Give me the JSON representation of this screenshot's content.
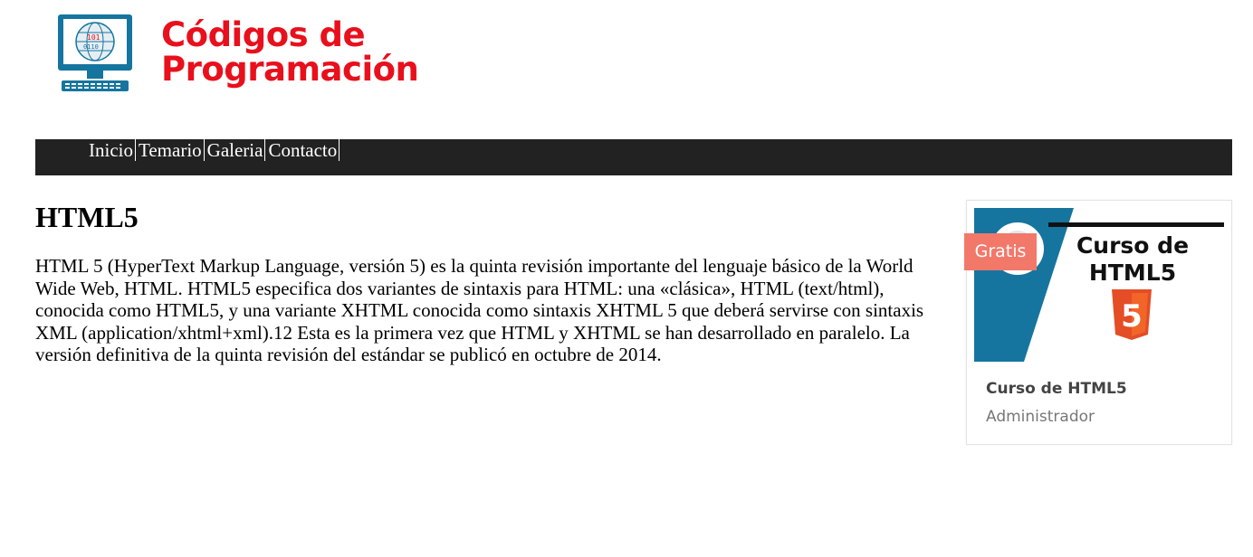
{
  "logo": {
    "line1": "Códigos de",
    "line2": "Programación",
    "icon": "computer-globe-icon",
    "color": "#e8101c"
  },
  "nav": {
    "items": [
      "Inicio",
      "Temario",
      "Galeria",
      "Contacto"
    ],
    "background": "#222222"
  },
  "main": {
    "title": "HTML5",
    "paragraph": "HTML 5 (HyperText Markup Language, versión 5) es la quinta revisión importante del lenguaje básico de la World Wide Web, HTML. HTML5 especifica dos variantes de sintaxis para HTML: una «clásica», HTML (text/html), conocida como HTML5, y una variante XHTML conocida como sintaxis XHTML 5 que deberá servirse con sintaxis XML (application/xhtml+xml).12 Esta es la primera vez que HTML y XHTML se han desarrollado en paralelo. La versión definitiva de la quinta revisión del estándar se publicó en octubre de 2014."
  },
  "card": {
    "badge": "Gratis",
    "image_title_line1": "Curso de",
    "image_title_line2": "HTML5",
    "image_icon": "html5-shield-icon",
    "title": "Curso de HTML5",
    "author": "Administrador",
    "badge_color": "#f2786a",
    "accent_color": "#15759f"
  }
}
